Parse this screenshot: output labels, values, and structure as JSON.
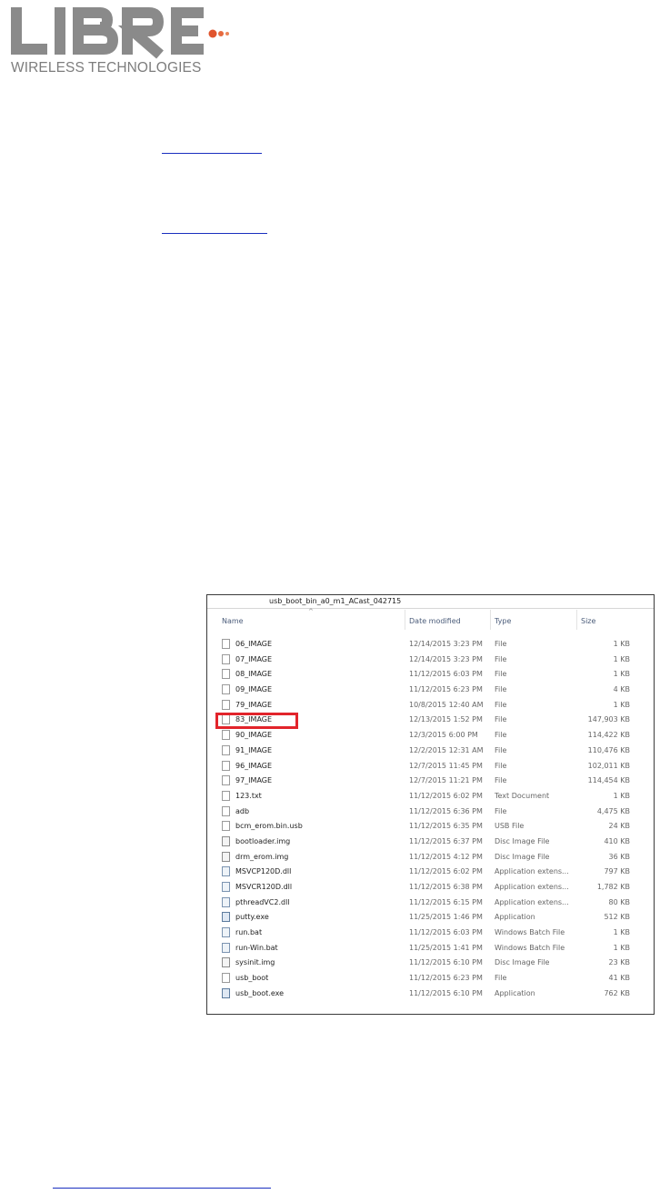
{
  "logo": {
    "wordmark": "LIBRE",
    "tagline": "WIRELESS TECHNOLOGIES",
    "colors": {
      "letters": "#8a8a8a",
      "dots": "#e0542d"
    }
  },
  "explorer": {
    "folder_name": "usb_boot_bin_a0_m1_ACast_042715",
    "columns": {
      "name": "Name",
      "date": "Date modified",
      "type": "Type",
      "size": "Size"
    },
    "highlighted_row": "83_IMAGE",
    "highlight_color": "#e2242b",
    "rows": [
      {
        "icon": "file-icon",
        "name": "06_IMAGE",
        "date": "12/14/2015 3:23 PM",
        "type": "File",
        "size": "1 KB"
      },
      {
        "icon": "file-icon",
        "name": "07_IMAGE",
        "date": "12/14/2015 3:23 PM",
        "type": "File",
        "size": "1 KB"
      },
      {
        "icon": "file-icon",
        "name": "08_IMAGE",
        "date": "11/12/2015 6:03 PM",
        "type": "File",
        "size": "1 KB"
      },
      {
        "icon": "file-icon",
        "name": "09_IMAGE",
        "date": "11/12/2015 6:23 PM",
        "type": "File",
        "size": "4 KB"
      },
      {
        "icon": "file-icon",
        "name": "79_IMAGE",
        "date": "10/8/2015 12:40 AM",
        "type": "File",
        "size": "1 KB"
      },
      {
        "icon": "file-icon",
        "name": "83_IMAGE",
        "date": "12/13/2015 1:52 PM",
        "type": "File",
        "size": "147,903 KB"
      },
      {
        "icon": "file-icon",
        "name": "90_IMAGE",
        "date": "12/3/2015 6:00 PM",
        "type": "File",
        "size": "114,422 KB"
      },
      {
        "icon": "file-icon",
        "name": "91_IMAGE",
        "date": "12/2/2015 12:31 AM",
        "type": "File",
        "size": "110,476 KB"
      },
      {
        "icon": "file-icon",
        "name": "96_IMAGE",
        "date": "12/7/2015 11:45 PM",
        "type": "File",
        "size": "102,011 KB"
      },
      {
        "icon": "file-icon",
        "name": "97_IMAGE",
        "date": "12/7/2015 11:21 PM",
        "type": "File",
        "size": "114,454 KB"
      },
      {
        "icon": "text-file-icon",
        "name": "123.txt",
        "date": "11/12/2015 6:02 PM",
        "type": "Text Document",
        "size": "1 KB"
      },
      {
        "icon": "file-icon",
        "name": "adb",
        "date": "11/12/2015 6:36 PM",
        "type": "File",
        "size": "4,475 KB"
      },
      {
        "icon": "file-icon",
        "name": "bcm_erom.bin.usb",
        "date": "11/12/2015 6:35 PM",
        "type": "USB File",
        "size": "24 KB"
      },
      {
        "icon": "disc-image-icon",
        "name": "bootloader.img",
        "date": "11/12/2015 6:37 PM",
        "type": "Disc Image File",
        "size": "410 KB"
      },
      {
        "icon": "disc-image-icon",
        "name": "drm_erom.img",
        "date": "11/12/2015 4:12 PM",
        "type": "Disc Image File",
        "size": "36 KB"
      },
      {
        "icon": "dll-gear-icon",
        "name": "MSVCP120D.dll",
        "date": "11/12/2015 6:02 PM",
        "type": "Application extens...",
        "size": "797 KB"
      },
      {
        "icon": "dll-gear-icon",
        "name": "MSVCR120D.dll",
        "date": "11/12/2015 6:38 PM",
        "type": "Application extens...",
        "size": "1,782 KB"
      },
      {
        "icon": "dll-gear-icon",
        "name": "pthreadVC2.dll",
        "date": "11/12/2015 6:15 PM",
        "type": "Application extens...",
        "size": "80 KB"
      },
      {
        "icon": "putty-app-icon",
        "name": "putty.exe",
        "date": "11/25/2015 1:46 PM",
        "type": "Application",
        "size": "512 KB"
      },
      {
        "icon": "batch-file-icon",
        "name": "run.bat",
        "date": "11/12/2015 6:03 PM",
        "type": "Windows Batch File",
        "size": "1 KB"
      },
      {
        "icon": "batch-file-icon",
        "name": "run-Win.bat",
        "date": "11/25/2015 1:41 PM",
        "type": "Windows Batch File",
        "size": "1 KB"
      },
      {
        "icon": "disc-image-icon",
        "name": "sysinit.img",
        "date": "11/12/2015 6:10 PM",
        "type": "Disc Image File",
        "size": "23 KB"
      },
      {
        "icon": "file-icon",
        "name": "usb_boot",
        "date": "11/12/2015 6:23 PM",
        "type": "File",
        "size": "41 KB"
      },
      {
        "icon": "application-icon",
        "name": "usb_boot.exe",
        "date": "11/12/2015 6:10 PM",
        "type": "Application",
        "size": "762 KB"
      }
    ]
  }
}
